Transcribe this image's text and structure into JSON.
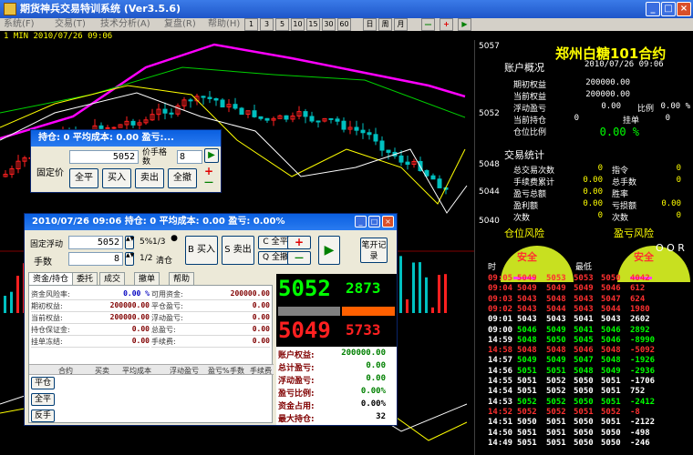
{
  "window": {
    "title": "期货神兵交易特训系统 (Ver3.5.6)",
    "minimize": "_",
    "maximize": "□",
    "close": "×"
  },
  "menu": [
    "系统(F)",
    "交易(T)",
    "技术分析(A)",
    "复盘(R)",
    "帮助(H)"
  ],
  "toolbar": {
    "periods": [
      "1",
      "3",
      "5",
      "10",
      "15",
      "30",
      "60",
      "日",
      "周",
      "月"
    ],
    "minus": "—",
    "plus": "+",
    "play": "▶"
  },
  "chart": {
    "info": "1 MIN  2010/07/26 09:06",
    "price_labels": [
      "5057",
      "5052",
      "5048",
      "5044",
      "5040"
    ],
    "colors": {
      "up": "#ff2020",
      "down": "#00c0c0",
      "ma_long": "#ff00ff",
      "ma_mid": "#00d000",
      "ma_short": "#ffff00"
    }
  },
  "contract": {
    "name": "郑州白糖101合约",
    "datetime": "2010/07/26 09:06"
  },
  "account": {
    "section": "账户概况",
    "items": [
      {
        "label": "期初权益",
        "value": "200000.00"
      },
      {
        "label": "当前权益",
        "value": "200000.00"
      },
      {
        "label": "浮动盈亏",
        "value": "0.00"
      },
      {
        "label": "当前持仓",
        "value": "0"
      },
      {
        "label": "仓位比例",
        "value": "0.00 %"
      }
    ],
    "profit_ratio_label": "比例",
    "profit_ratio_value": "0.00 %",
    "pending_label": "挂单",
    "pending_value": "0"
  },
  "trade_stats": {
    "section": "交易统计",
    "left": [
      {
        "label": "总交易次数",
        "value": "0"
      },
      {
        "label": "手续费累计",
        "value": "0.00"
      },
      {
        "label": "盈亏总额",
        "value": "0.00"
      },
      {
        "label": "盈利额",
        "value": "0.00"
      },
      {
        "label": "次数",
        "value": "0"
      }
    ],
    "right": [
      {
        "label": "指令",
        "value": "0"
      },
      {
        "label": "总手数",
        "value": "0"
      },
      {
        "label": "胜率",
        "value": ""
      },
      {
        "label": "亏损额",
        "value": "0.00"
      },
      {
        "label": "次数",
        "value": "0"
      }
    ]
  },
  "risk": {
    "position_risk": "仓位风险",
    "pnl_risk": "盈亏风险",
    "safe": "安全",
    "partial": "O O R"
  },
  "ticks": {
    "headers": [
      "时",
      "最低"
    ],
    "rows": [
      {
        "t": "09:05",
        "a": "5049",
        "b": "5053",
        "c": "5053",
        "d": "5050",
        "v": "4042",
        "col": "red"
      },
      {
        "t": "09:04",
        "a": "5049",
        "b": "5049",
        "c": "5049",
        "d": "5046",
        "v": "612",
        "col": "red"
      },
      {
        "t": "09:03",
        "a": "5043",
        "b": "5048",
        "c": "5043",
        "d": "5047",
        "v": "624",
        "col": "red"
      },
      {
        "t": "09:02",
        "a": "5043",
        "b": "5044",
        "c": "5043",
        "d": "5044",
        "v": "1980",
        "col": "red"
      },
      {
        "t": "09:01",
        "a": "5043",
        "b": "5043",
        "c": "5041",
        "d": "5043",
        "v": "2602",
        "col": "white"
      },
      {
        "t": "09:00",
        "a": "5046",
        "b": "5049",
        "c": "5041",
        "d": "5046",
        "v": "2892",
        "col": "green"
      },
      {
        "t": "14:59",
        "a": "5048",
        "b": "5050",
        "c": "5045",
        "d": "5046",
        "v": "-8990",
        "col": "green"
      },
      {
        "t": "14:58",
        "a": "5048",
        "b": "5048",
        "c": "5046",
        "d": "5048",
        "v": "-5092",
        "col": "red"
      },
      {
        "t": "14:57",
        "a": "5049",
        "b": "5049",
        "c": "5047",
        "d": "5048",
        "v": "-1926",
        "col": "green"
      },
      {
        "t": "14:56",
        "a": "5051",
        "b": "5051",
        "c": "5048",
        "d": "5049",
        "v": "-2936",
        "col": "green"
      },
      {
        "t": "14:55",
        "a": "5051",
        "b": "5052",
        "c": "5050",
        "d": "5051",
        "v": "-1706",
        "col": "white"
      },
      {
        "t": "14:54",
        "a": "5051",
        "b": "5052",
        "c": "5050",
        "d": "5051",
        "v": "752",
        "col": "white"
      },
      {
        "t": "14:53",
        "a": "5052",
        "b": "5052",
        "c": "5050",
        "d": "5051",
        "v": "-2412",
        "col": "green"
      },
      {
        "t": "14:52",
        "a": "5052",
        "b": "5052",
        "c": "5051",
        "d": "5052",
        "v": "-8",
        "col": "red"
      },
      {
        "t": "14:51",
        "a": "5050",
        "b": "5051",
        "c": "5050",
        "d": "5051",
        "v": "-2122",
        "col": "white"
      },
      {
        "t": "14:50",
        "a": "5051",
        "b": "5051",
        "c": "5050",
        "d": "5050",
        "v": "-498",
        "col": "white"
      },
      {
        "t": "14:49",
        "a": "5051",
        "b": "5051",
        "c": "5050",
        "d": "5050",
        "v": "-246",
        "col": "white"
      }
    ]
  },
  "mini": {
    "title": "持仓: 0 平均成本: 0.00 盈亏:...",
    "fixed_price": "固定价",
    "price_value": "5052",
    "price_type": "价手格数",
    "lots_value": "8",
    "close_all": "全平",
    "buy": "买入",
    "sell": "卖出",
    "cancel_all": "全撤",
    "plus": "+",
    "minus": "—",
    "play": "▶"
  },
  "order": {
    "title": "2010/07/26 09:06   持仓: 0 平均成本: 0.00 盈亏: 0.00%",
    "float_label": "固定浮动",
    "float_value": "5052",
    "lots_label": "手数",
    "lots_value": "8",
    "pct5": "5%",
    "pct13": "1/3",
    "half": "1/2",
    "clear": "清仓",
    "buy": "买入",
    "sell": "卖出",
    "close_all": "全平",
    "cancel_all": "全撤",
    "buy_key": "B",
    "sell_key": "S",
    "close_key": "C",
    "cancel_key": "Q",
    "plus": "+",
    "minus": "—",
    "play": "▶",
    "note": "笔开记录",
    "tabs": [
      "资金/持仓",
      "委托",
      "成交",
      "撤单",
      "帮助"
    ],
    "grid_left": [
      {
        "label": "资金风险率:",
        "value": "0.00 %"
      },
      {
        "label": "期初权益:",
        "value": "200000.00"
      },
      {
        "label": "当前权益:",
        "value": "200000.00"
      },
      {
        "label": "持仓保证金:",
        "value": "0.00"
      },
      {
        "label": "挂单冻结:",
        "value": "0.00"
      }
    ],
    "grid_right": [
      {
        "label": "可用资金:",
        "value": "200000.00"
      },
      {
        "label": "平仓盈亏:",
        "value": "0.00"
      },
      {
        "label": "浮动盈亏:",
        "value": "0.00"
      },
      {
        "label": "总盈亏:",
        "value": "0.00"
      },
      {
        "label": "手续费:",
        "value": "0.00"
      }
    ],
    "pos_headers": [
      "合约",
      "买卖",
      "平均成本",
      "浮动盈亏",
      "盈亏%",
      "手数",
      "手续费"
    ],
    "side_buttons": [
      "平仓",
      "全平",
      "反手"
    ],
    "quote": {
      "bid": "5052",
      "bid_vol": "2873",
      "ask": "5049",
      "ask_vol": "5733"
    },
    "summary": [
      {
        "label": "账户权益:",
        "value": "200000.00"
      },
      {
        "label": "总计盈亏:",
        "value": "0.00"
      },
      {
        "label": "浮动盈亏:",
        "value": "0.00"
      },
      {
        "label": "盈亏比例:",
        "value": "0.00%"
      },
      {
        "label": "资金占用:",
        "value": "0.00%"
      },
      {
        "label": "最大持仓:",
        "value": "32"
      }
    ]
  }
}
